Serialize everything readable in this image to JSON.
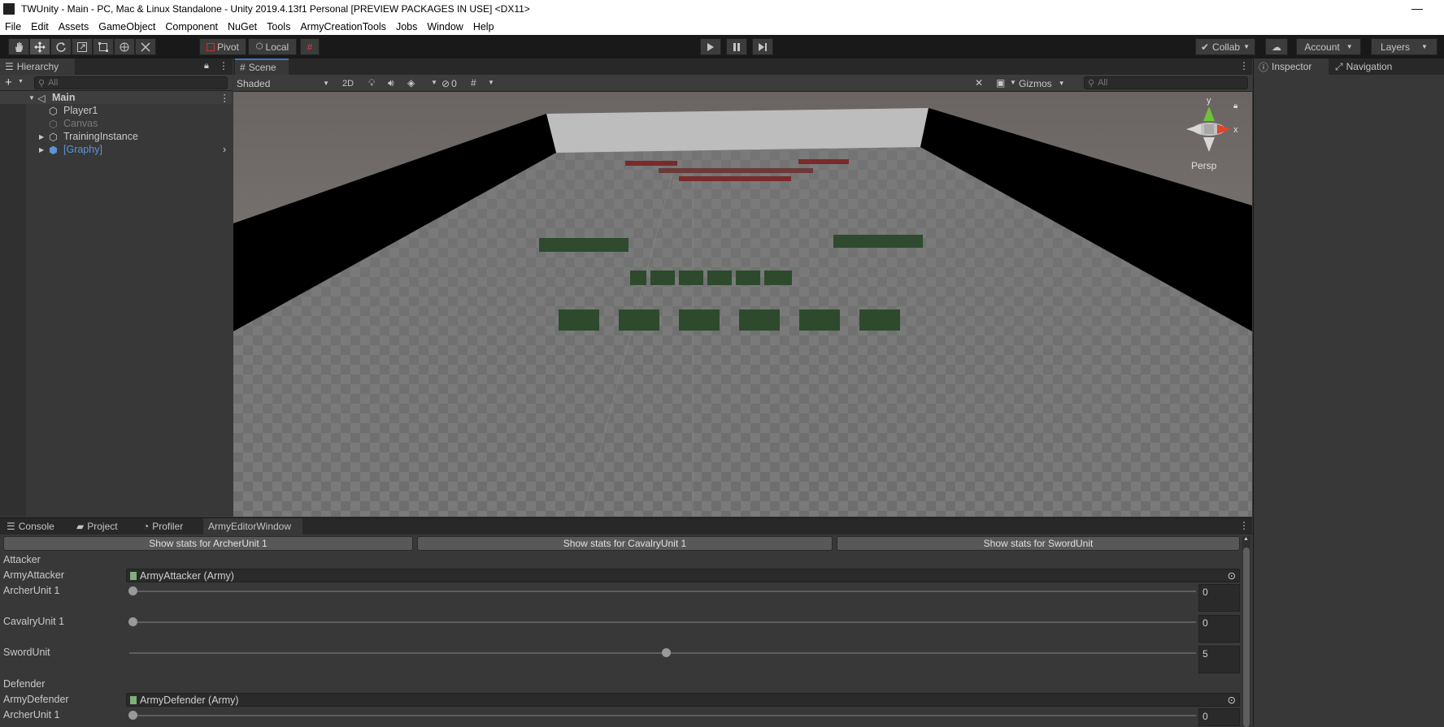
{
  "window": {
    "title": "TWUnity - Main - PC, Mac & Linux Standalone - Unity 2019.4.13f1 Personal [PREVIEW PACKAGES IN USE] <DX11>",
    "minimize": "—"
  },
  "menu": [
    "File",
    "Edit",
    "Assets",
    "GameObject",
    "Component",
    "NuGet",
    "Tools",
    "ArmyCreationTools",
    "Jobs",
    "Window",
    "Help"
  ],
  "toolbar": {
    "pivot": "Pivot",
    "local": "Local",
    "collab": "Collab",
    "account": "Account",
    "layers": "Layers"
  },
  "hierarchy": {
    "tab": "Hierarchy",
    "search_placeholder": "All",
    "scene_name": "Main",
    "items": [
      "Player1",
      "Canvas",
      "TrainingInstance",
      "[Graphy]"
    ]
  },
  "scene": {
    "tab": "Scene",
    "shading": "Shaded",
    "mode2d": "2D",
    "hidden_count": "0",
    "gizmos": "Gizmos",
    "search_placeholder": "All",
    "persp": "Persp",
    "axis_y": "y",
    "axis_x": "x"
  },
  "right": {
    "inspector": "Inspector",
    "navigation": "Navigation"
  },
  "bottom": {
    "tabs": [
      "Console",
      "Project",
      "Profiler",
      "ArmyEditorWindow"
    ],
    "buttons": [
      "Show stats for ArcherUnit 1",
      "Show stats for CavalryUnit 1",
      "Show stats for SwordUnit"
    ],
    "attacker": {
      "header": "Attacker",
      "army_label": "ArmyAttacker",
      "army_value": "ArmyAttacker (Army)",
      "units": [
        {
          "label": "ArcherUnit 1",
          "value": "0",
          "fraction": 0
        },
        {
          "label": "CavalryUnit 1",
          "value": "0",
          "fraction": 0
        },
        {
          "label": "SwordUnit",
          "value": "5",
          "fraction": 0.5
        }
      ]
    },
    "defender": {
      "header": "Defender",
      "army_label": "ArmyDefender",
      "army_value": "ArmyDefender (Army)",
      "units": [
        {
          "label": "ArcherUnit 1",
          "value": "0",
          "fraction": 0
        }
      ]
    }
  }
}
